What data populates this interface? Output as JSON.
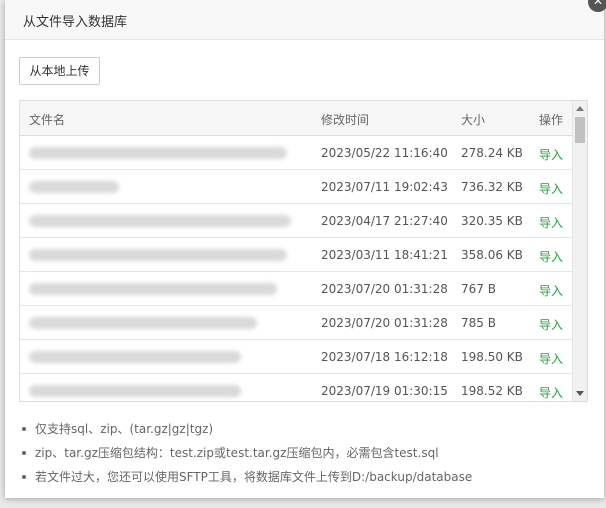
{
  "dialog": {
    "title": "从文件导入数据库",
    "close_icon": "close-icon"
  },
  "toolbar": {
    "upload_label": "从本地上传"
  },
  "table": {
    "headers": {
      "filename": "文件名",
      "mtime": "修改时间",
      "size": "大小",
      "action": "操作"
    },
    "rows": [
      {
        "mtime": "2023/05/22 11:16:40",
        "size": "278.24 KB",
        "action": "导入"
      },
      {
        "mtime": "2023/07/11 19:02:43",
        "size": "736.32 KB",
        "action": "导入"
      },
      {
        "mtime": "2023/04/17 21:27:40",
        "size": "320.35 KB",
        "action": "导入"
      },
      {
        "mtime": "2023/03/11 18:41:21",
        "size": "358.06 KB",
        "action": "导入"
      },
      {
        "mtime": "2023/07/20 01:31:28",
        "size": "767 B",
        "action": "导入"
      },
      {
        "mtime": "2023/07/20 01:31:28",
        "size": "785 B",
        "action": "导入"
      },
      {
        "mtime": "2023/07/18 16:12:18",
        "size": "198.50 KB",
        "action": "导入"
      },
      {
        "mtime": "2023/07/19 01:30:15",
        "size": "198.52 KB",
        "action": "导入"
      }
    ]
  },
  "notes": [
    "仅支持sql、zip、(tar.gz|gz|tgz)",
    "zip、tar.gz压缩包结构：test.zip或test.tar.gz压缩包内，必需包含test.sql",
    "若文件过大，您还可以使用SFTP工具，将数据库文件上传到D:/backup/database"
  ],
  "colors": {
    "accent": "#20a53a"
  }
}
